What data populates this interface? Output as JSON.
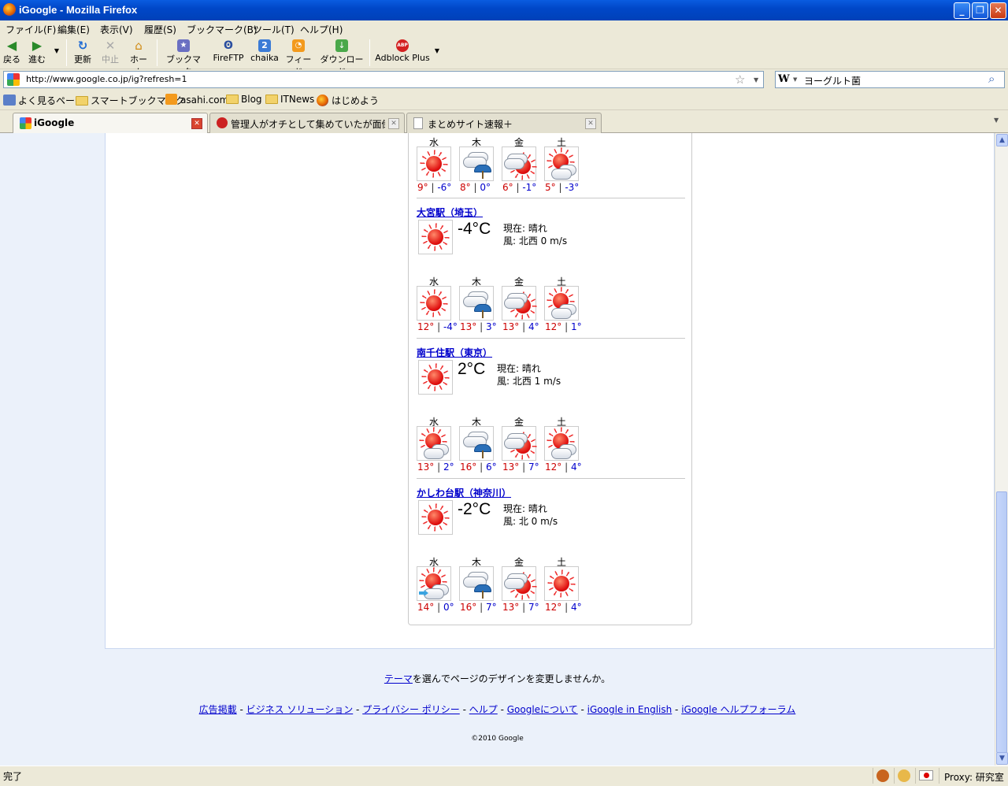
{
  "window": {
    "title": "iGoogle - Mozilla Firefox"
  },
  "menu": [
    "ファイル(F)",
    "編集(E)",
    "表示(V)",
    "履歴(S)",
    "ブックマーク(B)",
    "ツール(T)",
    "ヘルプ(H)"
  ],
  "toolbar": {
    "back": "戻る",
    "forward": "進む",
    "reload": "更新",
    "stop": "中止",
    "home": "ホーム",
    "bookmarks": "ブックマーク",
    "fireftp": "FireFTP",
    "chaika": "chaika",
    "feed": "フィード",
    "download": "ダウンロード",
    "adblock": "Adblock Plus"
  },
  "navbar": {
    "url": "http://www.google.co.jp/ig?refresh=1",
    "search_engine": "W",
    "search_value": "ヨーグルト菌"
  },
  "bookmarks_bar": [
    "よく見るページ",
    "スマートブックマーク",
    "asahi.com",
    "Blog",
    "ITNews",
    "はじめよう"
  ],
  "tabs": [
    {
      "label": "iGoogle",
      "active": true
    },
    {
      "label": "管理人がオチとして集めていたが面倒くさ...",
      "active": false
    },
    {
      "label": "まとめサイト速報＋",
      "active": false
    }
  ],
  "weather": {
    "days": [
      "水",
      "木",
      "金",
      "土"
    ],
    "first_forecast": [
      {
        "icon": "sunny",
        "high": "9°",
        "low": "-6°"
      },
      {
        "icon": "cloudy-umbrella",
        "high": "8°",
        "low": "0°"
      },
      {
        "icon": "cloudy-sun",
        "high": "6°",
        "low": "-1°"
      },
      {
        "icon": "sun-cloud",
        "high": "5°",
        "low": "-3°"
      }
    ],
    "cities": [
      {
        "name": "大宮駅（埼玉）",
        "temp": "-4°C",
        "current": "現在: 晴れ",
        "wind": "風: 北西 0 m/s",
        "forecast": [
          {
            "icon": "sunny",
            "high": "12°",
            "low": "-4°"
          },
          {
            "icon": "cloudy-umbrella",
            "high": "13°",
            "low": "3°"
          },
          {
            "icon": "cloudy-sun",
            "high": "13°",
            "low": "4°"
          },
          {
            "icon": "sun-cloud",
            "high": "12°",
            "low": "1°"
          }
        ]
      },
      {
        "name": "南千住駅（東京）",
        "temp": "2°C",
        "current": "現在: 晴れ",
        "wind": "風: 北西 1 m/s",
        "forecast": [
          {
            "icon": "sun-cloud",
            "high": "13°",
            "low": "2°"
          },
          {
            "icon": "cloudy-umbrella",
            "high": "16°",
            "low": "6°"
          },
          {
            "icon": "cloudy-sun",
            "high": "13°",
            "low": "7°"
          },
          {
            "icon": "sun-cloud",
            "high": "12°",
            "low": "4°"
          }
        ]
      },
      {
        "name": "かしわ台駅（神奈川）",
        "temp": "-2°C",
        "current": "現在: 晴れ",
        "wind": "風: 北 0 m/s",
        "forecast": [
          {
            "icon": "sun-cloud-arrow",
            "high": "14°",
            "low": "0°"
          },
          {
            "icon": "cloudy-umbrella",
            "high": "16°",
            "low": "7°"
          },
          {
            "icon": "cloudy-sun",
            "high": "13°",
            "low": "7°"
          },
          {
            "icon": "sunny",
            "high": "12°",
            "low": "4°"
          }
        ]
      }
    ]
  },
  "footer": {
    "theme_link": "テーマ",
    "theme_text": "を選んでページのデザインを変更しませんか。",
    "links": [
      "広告掲載",
      "ビジネス ソリューション",
      "プライバシー ポリシー",
      "ヘルプ",
      "Googleについて",
      "iGoogle in English",
      "iGoogle ヘルプフォーラム"
    ],
    "copyright": "©2010 Google"
  },
  "status": {
    "text": "完了",
    "proxy": "Proxy: 研究室"
  }
}
